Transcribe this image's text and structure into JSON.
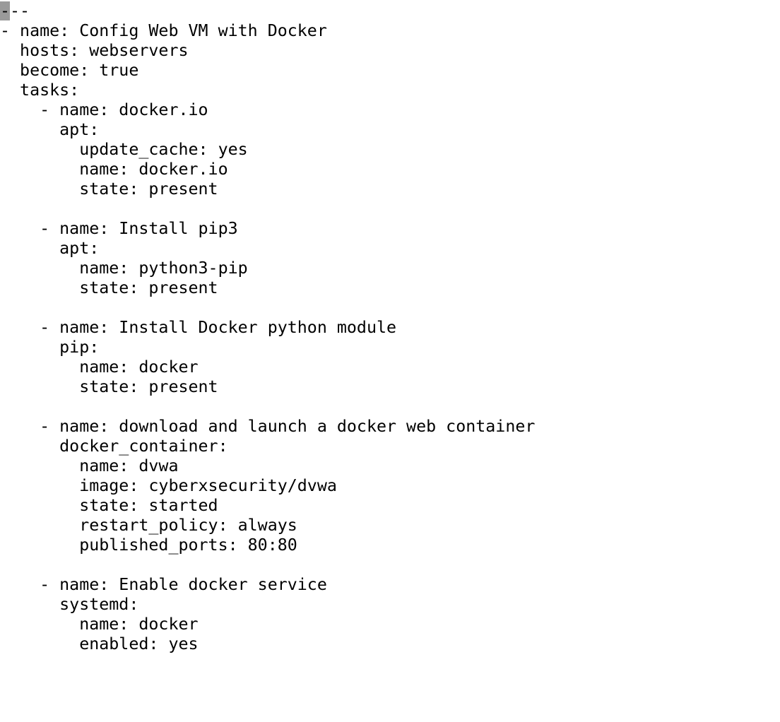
{
  "terminal": {
    "cursor_char": "-",
    "first_line_rest": "--",
    "lines": [
      "- name: Config Web VM with Docker",
      "  hosts: webservers",
      "  become: true",
      "  tasks:",
      "    - name: docker.io",
      "      apt:",
      "        update_cache: yes",
      "        name: docker.io",
      "        state: present",
      "",
      "    - name: Install pip3",
      "      apt:",
      "        name: python3-pip",
      "        state: present",
      "",
      "    - name: Install Docker python module",
      "      pip:",
      "        name: docker",
      "        state: present",
      "",
      "    - name: download and launch a docker web container",
      "      docker_container:",
      "        name: dvwa",
      "        image: cyberxsecurity/dvwa",
      "        state: started",
      "        restart_policy: always",
      "        published_ports: 80:80",
      "",
      "    - name: Enable docker service",
      "      systemd:",
      "        name: docker",
      "        enabled: yes"
    ],
    "colors": {
      "background": "#ffffff",
      "text": "#000000",
      "cursor": "#9a9a9a"
    }
  }
}
